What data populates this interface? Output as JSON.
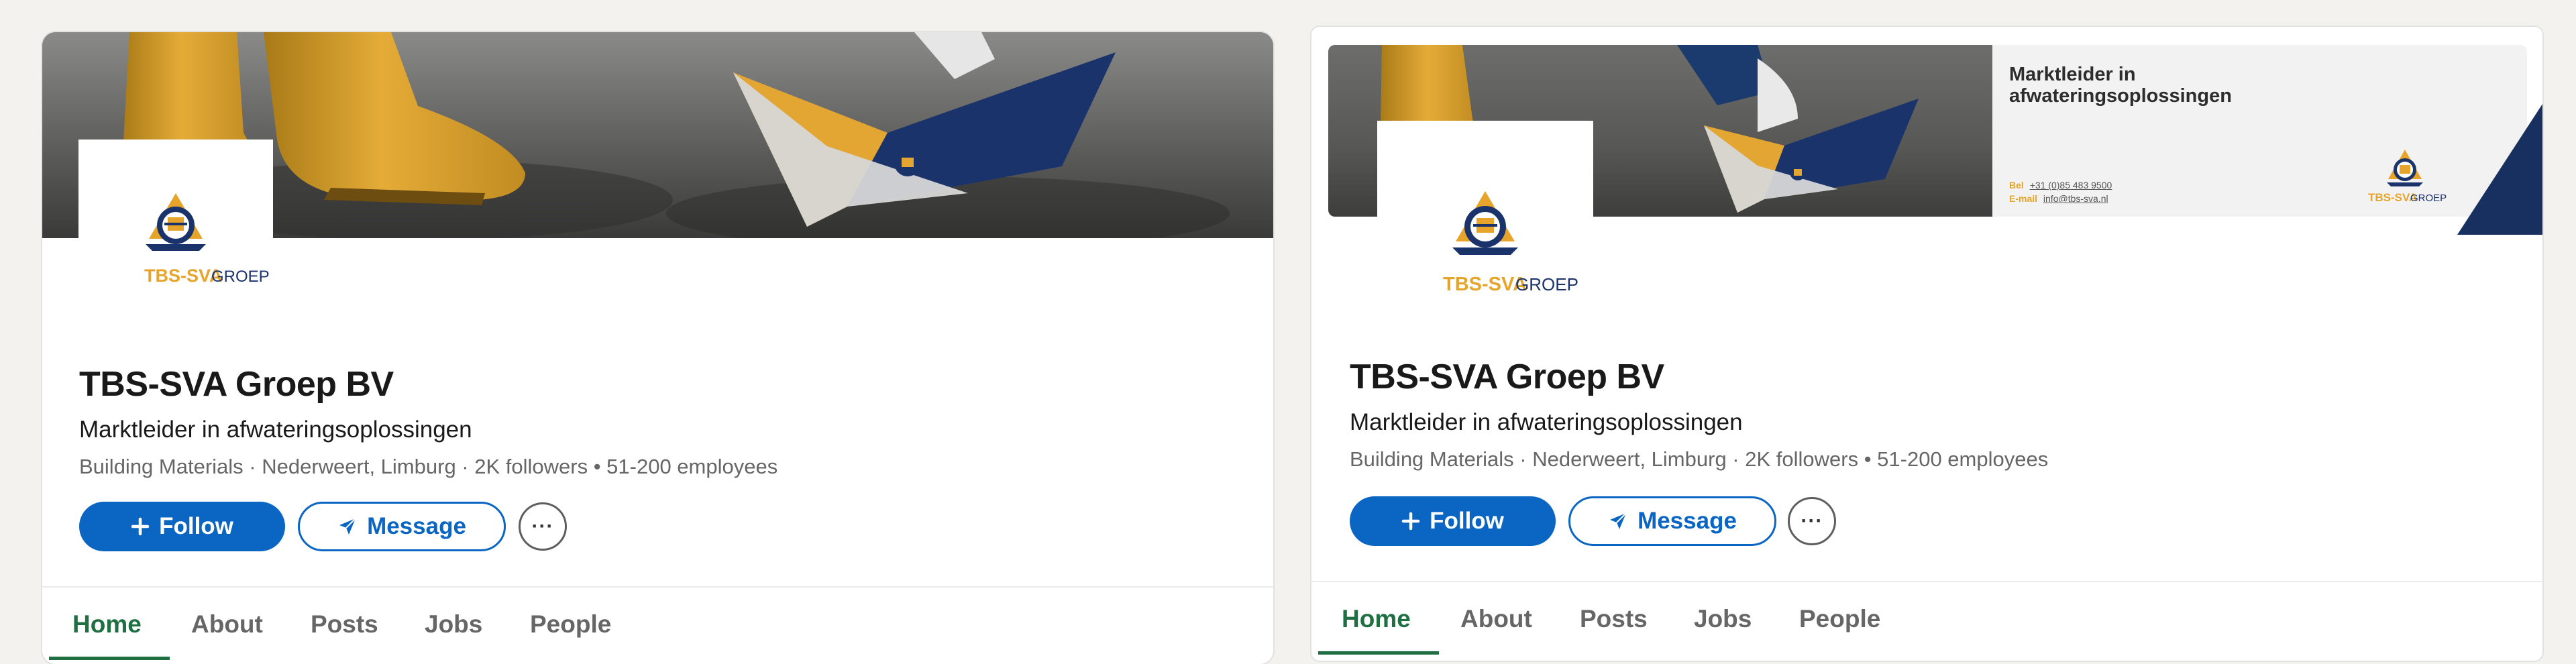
{
  "company": {
    "name": "TBS-SVA Groep BV",
    "tagline": "Marktleider in afwateringsoplossingen",
    "meta": "Building Materials · Nederweert, Limburg · 2K followers • 51-200 employees"
  },
  "logo": {
    "brand": "TBS-SVA",
    "suffix": " GROEP"
  },
  "actions": {
    "follow": "Follow",
    "message": "Message",
    "more": "···"
  },
  "tabs": [
    "Home",
    "About",
    "Posts",
    "Jobs",
    "People"
  ],
  "banner": {
    "title": "Marktleider in afwateringsoplossingen",
    "phone_label": "Bel",
    "phone": "+31 (0)85 483 9500",
    "email_label": "E-mail",
    "email": "info@tbs-sva.nl"
  },
  "colors": {
    "accent": "#0a66c2",
    "tab_active": "#1f6f43",
    "brand_yellow": "#e6a52a",
    "brand_navy": "#17305f"
  },
  "icons": {
    "follow": "plus-icon",
    "message": "paper-plane-icon",
    "more": "ellipsis-icon"
  }
}
